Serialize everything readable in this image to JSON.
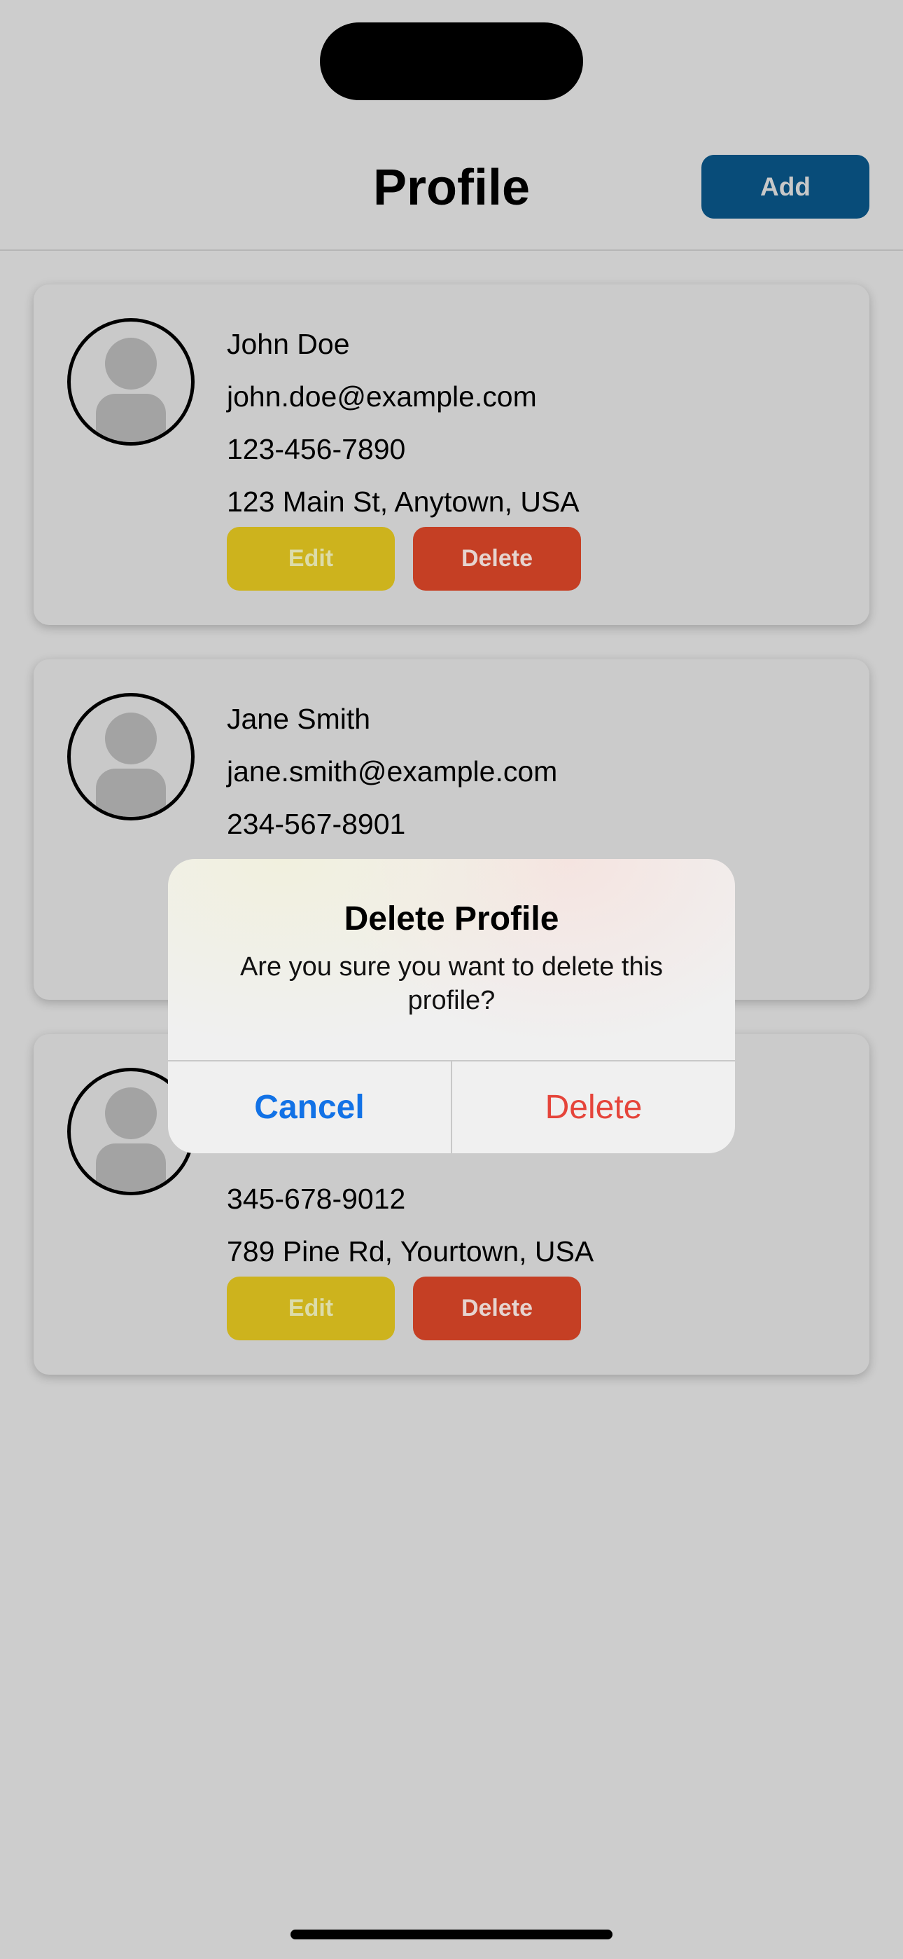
{
  "header": {
    "title": "Profile",
    "add_label": "Add"
  },
  "profiles": [
    {
      "name": "John Doe",
      "email": "john.doe@example.com",
      "phone": "123-456-7890",
      "address": "123 Main St, Anytown, USA",
      "edit_label": "Edit",
      "delete_label": "Delete"
    },
    {
      "name": "Jane Smith",
      "email": "jane.smith@example.com",
      "phone": "234-567-8901"
    },
    {
      "phone": "345-678-9012",
      "address": "789 Pine Rd, Yourtown, USA",
      "edit_label": "Edit",
      "delete_label": "Delete"
    }
  ],
  "dialog": {
    "title": "Delete Profile",
    "message": "Are you sure you want to delete this profile?",
    "cancel_label": "Cancel",
    "confirm_label": "Delete"
  },
  "colors": {
    "add_button": "#084c79",
    "edit_button": "#cdb31d",
    "delete_button": "#c53f24",
    "cancel_text": "#1272e6",
    "destructive_text": "#e5443a"
  }
}
